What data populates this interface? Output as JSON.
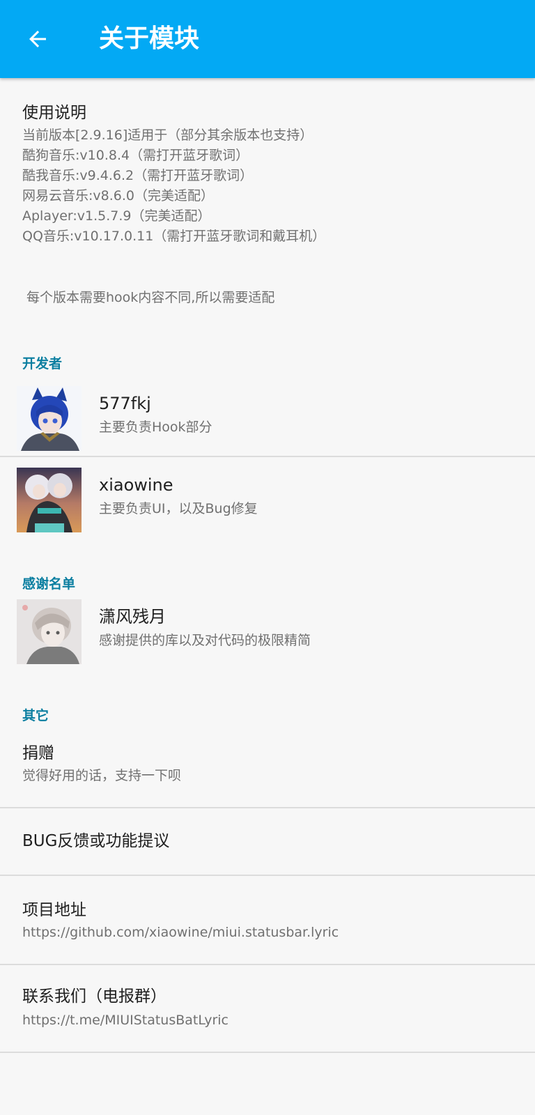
{
  "app_bar": {
    "title": "关于模块",
    "back_icon": "arrow-back-icon",
    "color": "#03a9f4"
  },
  "usage": {
    "title": "使用说明",
    "lines": [
      "当前版本[2.9.16]适用于（部分其余版本也支持）",
      "酷狗音乐:v10.8.4（需打开蓝牙歌词）",
      "酷我音乐:v9.4.6.2（需打开蓝牙歌词）",
      "网易云音乐:v8.6.0（完美适配）",
      "Aplayer:v1.5.7.9（完美适配）",
      "QQ音乐:v10.17.0.11（需打开蓝牙歌词和戴耳机）"
    ],
    "note": "每个版本需要hook内容不同,所以需要适配"
  },
  "developers": {
    "header": "开发者",
    "items": [
      {
        "name": "577fkj",
        "desc": "主要负责Hook部分",
        "avatar": "avatar-577fkj"
      },
      {
        "name": "xiaowine",
        "desc": "主要负责UI，以及Bug修复",
        "avatar": "avatar-xiaowine"
      }
    ]
  },
  "thanks": {
    "header": "感谢名单",
    "items": [
      {
        "name": "潇风残月",
        "desc": "感谢提供的库以及对代码的极限精简",
        "avatar": "avatar-xiaofengcanyue"
      }
    ]
  },
  "other": {
    "header": "其它",
    "donate": {
      "title": "捐赠",
      "summary": "觉得好用的话，支持一下呗"
    },
    "feedback": {
      "title": "BUG反馈或功能提议"
    },
    "project": {
      "title": "项目地址",
      "summary": "https://github.com/xiaowine/miui.statusbar.lyric"
    },
    "contact": {
      "title": "联系我们（电报群）",
      "summary": "https://t.me/MIUIStatusBatLyric"
    }
  },
  "colors": {
    "accent": "#03a9f4",
    "section_header": "#0a7ea0",
    "background": "#f7f7f7"
  }
}
